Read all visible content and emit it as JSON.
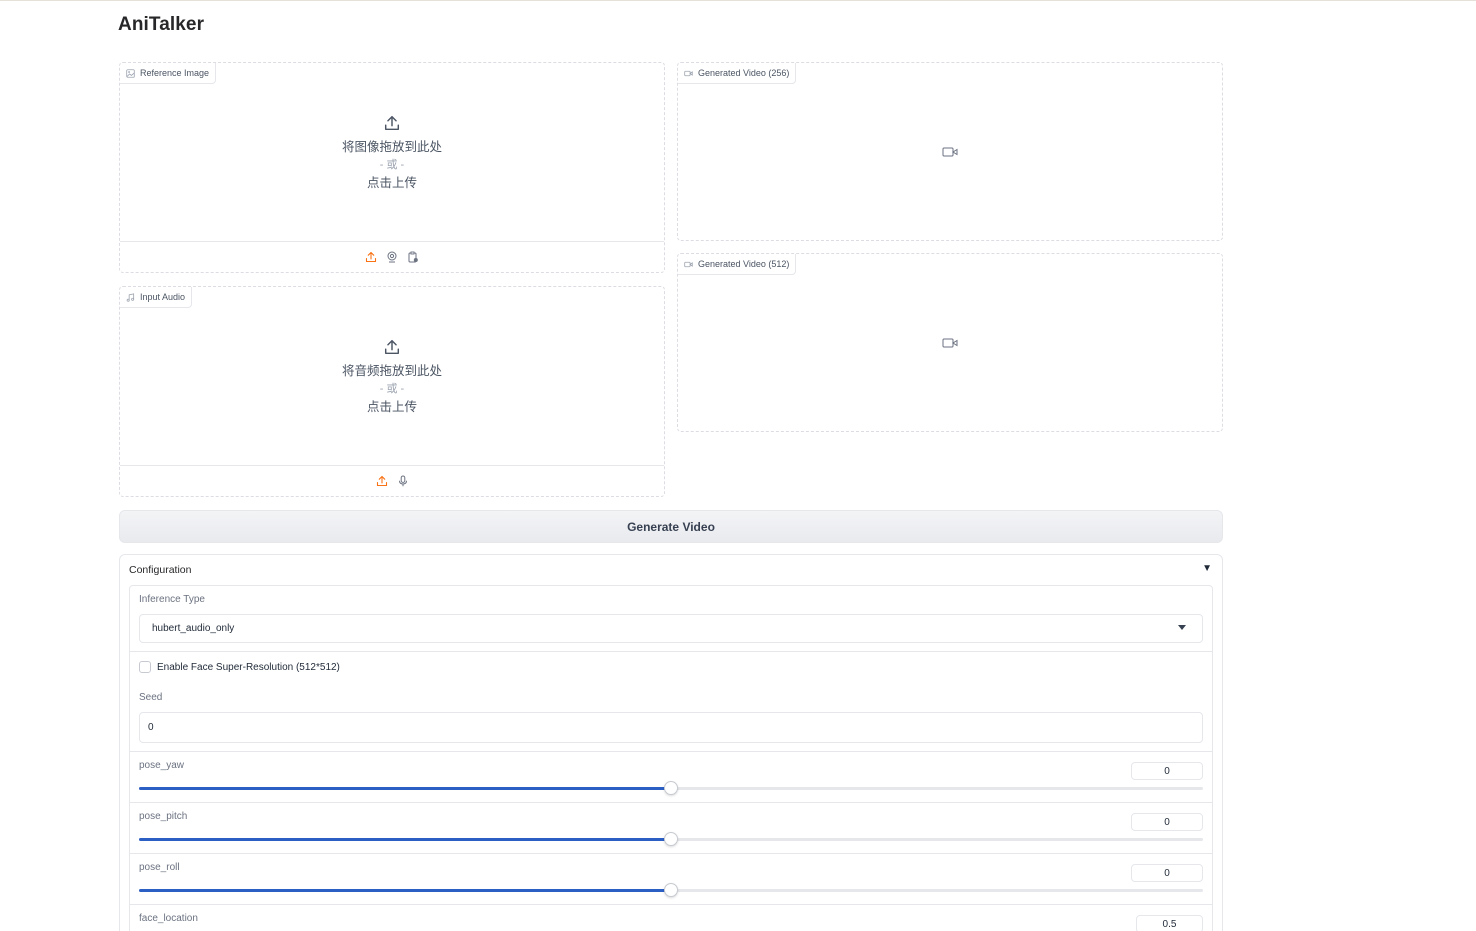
{
  "app": {
    "title": "AniTalker"
  },
  "reference_image": {
    "label": "Reference Image",
    "drop_text": "将图像拖放到此处",
    "or_text": "- 或 -",
    "click_text": "点击上传",
    "sources": [
      "upload-icon",
      "webcam-icon",
      "clipboard-icon"
    ]
  },
  "input_audio": {
    "label": "Input Audio",
    "drop_text": "将音频拖放到此处",
    "or_text": "- 或 -",
    "click_text": "点击上传",
    "sources": [
      "upload-icon",
      "microphone-icon"
    ]
  },
  "video_256": {
    "label": "Generated Video (256)"
  },
  "video_512": {
    "label": "Generated Video (512)"
  },
  "generate_button": {
    "label": "Generate Video"
  },
  "configuration": {
    "title": "Configuration",
    "collapse_glyph": "▼",
    "inference_type": {
      "label": "Inference Type",
      "value": "hubert_audio_only"
    },
    "super_resolution": {
      "label": "Enable Face Super-Resolution (512*512)",
      "checked": false
    },
    "seed": {
      "label": "Seed",
      "value": "0"
    },
    "sliders": [
      {
        "name": "pose_yaw",
        "label": "pose_yaw",
        "value": "0",
        "fraction": 0.5
      },
      {
        "name": "pose_pitch",
        "label": "pose_pitch",
        "value": "0",
        "fraction": 0.5
      },
      {
        "name": "pose_roll",
        "label": "pose_roll",
        "value": "0",
        "fraction": 0.5
      },
      {
        "name": "face_location",
        "label": "face_location",
        "value": "0.5",
        "fraction": 0.5
      }
    ]
  },
  "colors": {
    "accent": "#2c5fc4",
    "upload_accent": "#f97316"
  }
}
